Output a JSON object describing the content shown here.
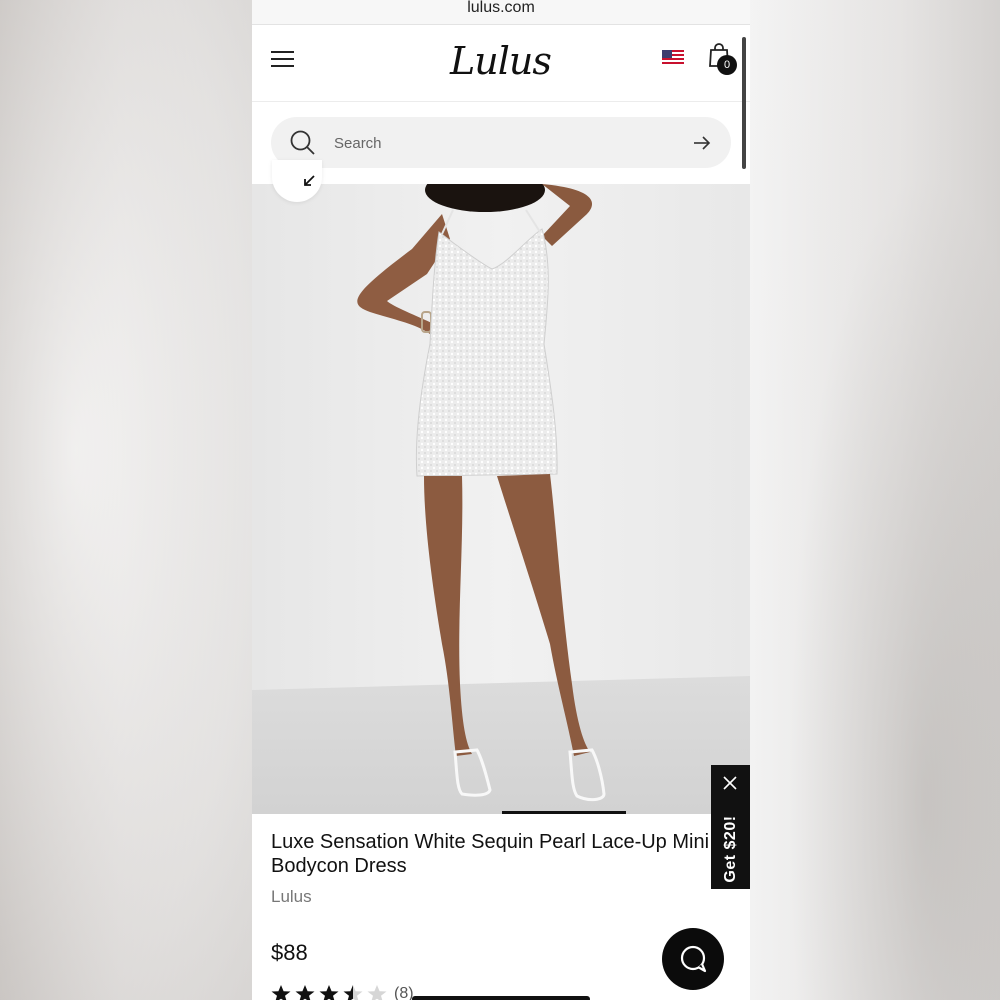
{
  "browser": {
    "url": "lulus.com"
  },
  "header": {
    "logo_text": "Lulus",
    "icons": [
      "menu-icon",
      "us-flag-icon",
      "shopping-bag-icon"
    ],
    "cart_count": "0"
  },
  "search": {
    "placeholder": "Search"
  },
  "product": {
    "title_line1": "Luxe Sensation White Sequin Pearl Lace-Up Mini",
    "title_line2": "Bodycon Dress",
    "brand": "Lulus",
    "price": "$88",
    "rating": 3.5,
    "rating_max": 5,
    "review_count": "(8)"
  },
  "promo": {
    "label": "Get $20!"
  },
  "colors": {
    "accent": "#111111",
    "search_bg": "#f1f1f1"
  }
}
